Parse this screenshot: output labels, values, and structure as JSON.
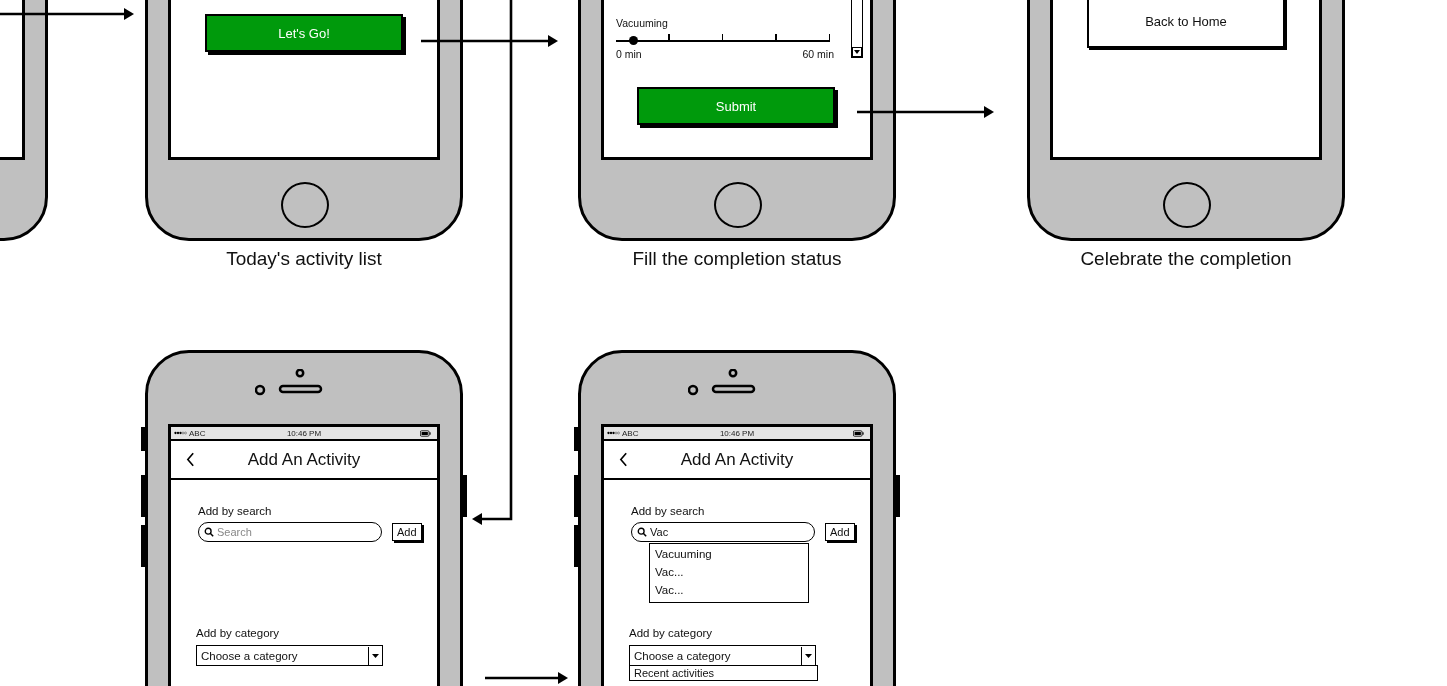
{
  "screens": [
    {
      "kind": "start",
      "button": "Let's Go!",
      "caption": "Today's activity list"
    },
    {
      "kind": "status",
      "slider": {
        "label": "Vacuuming",
        "level": 0.06,
        "min": "0 min",
        "max": "60 min"
      },
      "button": "Submit",
      "caption": "Fill the completion status"
    },
    {
      "kind": "done",
      "button": "Back to Home",
      "caption": "Celebrate the completion"
    }
  ],
  "add_screens": [
    {
      "status_bar": {
        "carrier": "ABC",
        "time": "10:46 PM"
      },
      "title": "Add An Activity",
      "search_label": "Add by search",
      "search": {
        "placeholder": "Search"
      },
      "add_button": "Add",
      "category_label": "Add by category",
      "category": {
        "value": "Choose a category"
      }
    },
    {
      "status_bar": {
        "carrier": "ABC",
        "time": "10:46 PM"
      },
      "title": "Add An Activity",
      "search_label": "Add by search",
      "search": {
        "value": "Vac"
      },
      "add_button": "Add",
      "suggestions": [
        "Vacuuming",
        "Vac...",
        "Vac..."
      ],
      "category_label": "Add by category",
      "category": {
        "value": "Choose a category"
      },
      "category_options": [
        "Recent activities"
      ]
    }
  ]
}
